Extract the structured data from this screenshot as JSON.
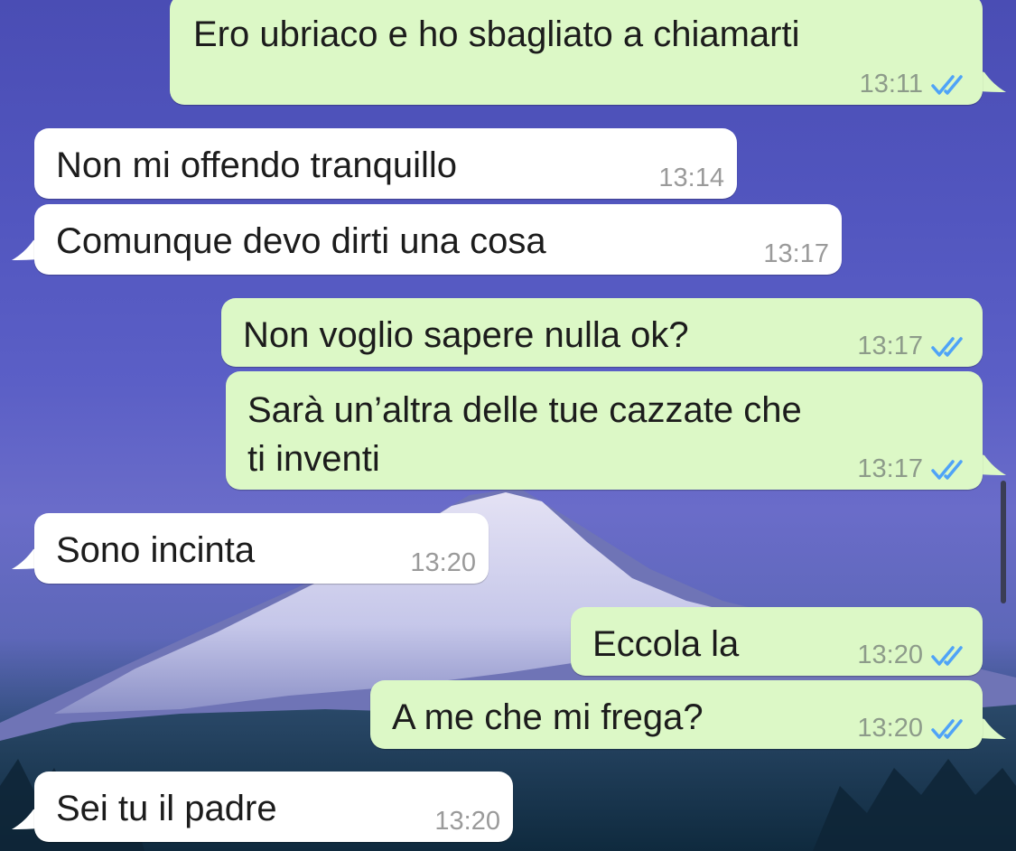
{
  "messages": [
    {
      "direction": "sent",
      "text_lines": [
        "Ero ubriaco e ho sbagliato a chiamarti"
      ],
      "time": "13:11",
      "status": "read"
    },
    {
      "direction": "received",
      "text_lines": [
        "Non mi offendo tranquillo"
      ],
      "time": "13:14"
    },
    {
      "direction": "received",
      "text_lines": [
        "Comunque devo dirti una cosa"
      ],
      "time": "13:17"
    },
    {
      "direction": "sent",
      "text_lines": [
        "Non voglio sapere nulla ok?"
      ],
      "time": "13:17",
      "status": "read"
    },
    {
      "direction": "sent",
      "text_lines": [
        "Sarà un’altra delle tue cazzate che",
        "ti inventi"
      ],
      "time": "13:17",
      "status": "read"
    },
    {
      "direction": "received",
      "text_lines": [
        "Sono incinta"
      ],
      "time": "13:20"
    },
    {
      "direction": "sent",
      "text_lines": [
        "Eccola la"
      ],
      "time": "13:20",
      "status": "read"
    },
    {
      "direction": "sent",
      "text_lines": [
        "A me che mi frega?"
      ],
      "time": "13:20",
      "status": "read"
    },
    {
      "direction": "received",
      "text_lines": [
        "Sei tu il padre"
      ],
      "time": "13:20"
    }
  ],
  "colors": {
    "sent_bubble": "#dcf8c6",
    "received_bubble": "#ffffff",
    "read_ticks": "#4fa3f7",
    "timestamp": "#8d9b8a"
  },
  "icons": {
    "read_receipt": "double-check-icon"
  },
  "background": "snowy-mountain-wallpaper"
}
